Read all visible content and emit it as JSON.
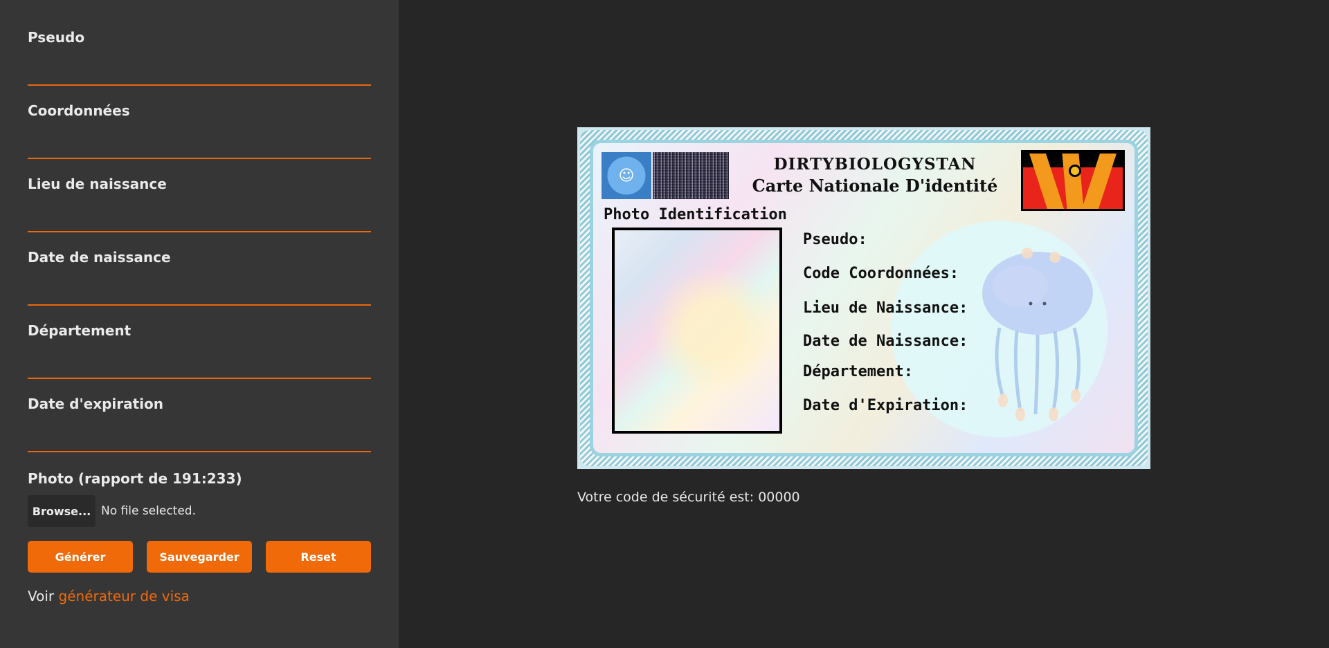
{
  "form": {
    "fields": [
      {
        "label": "Pseudo",
        "value": ""
      },
      {
        "label": "Coordonnées",
        "value": ""
      },
      {
        "label": "Lieu de naissance",
        "value": ""
      },
      {
        "label": "Date de naissance",
        "value": ""
      },
      {
        "label": "Département",
        "value": ""
      },
      {
        "label": "Date d'expiration",
        "value": ""
      }
    ],
    "photo_label": "Photo (rapport de 191:233)",
    "browse_label": "Browse...",
    "file_status": "No file selected.",
    "buttons": {
      "generate": "Générer",
      "save": "Sauvegarder",
      "reset": "Reset"
    },
    "visa_prefix": "Voir",
    "visa_link": "générateur de visa"
  },
  "card": {
    "country": "DIRTYBIOLOGYSTAN",
    "title": "Carte Nationale D'identité",
    "photo_heading": "Photo Identification",
    "fields": [
      "Pseudo:",
      "Code Coordonnées:",
      "Lieu de Naissance:",
      "Date de Naissance:",
      "Département:",
      "Date d'Expiration:"
    ]
  },
  "security_text": "Votre code de sécurité est: 00000",
  "colors": {
    "accent": "#f06a0a",
    "sidebar_bg": "#363636",
    "page_bg": "#262626"
  }
}
